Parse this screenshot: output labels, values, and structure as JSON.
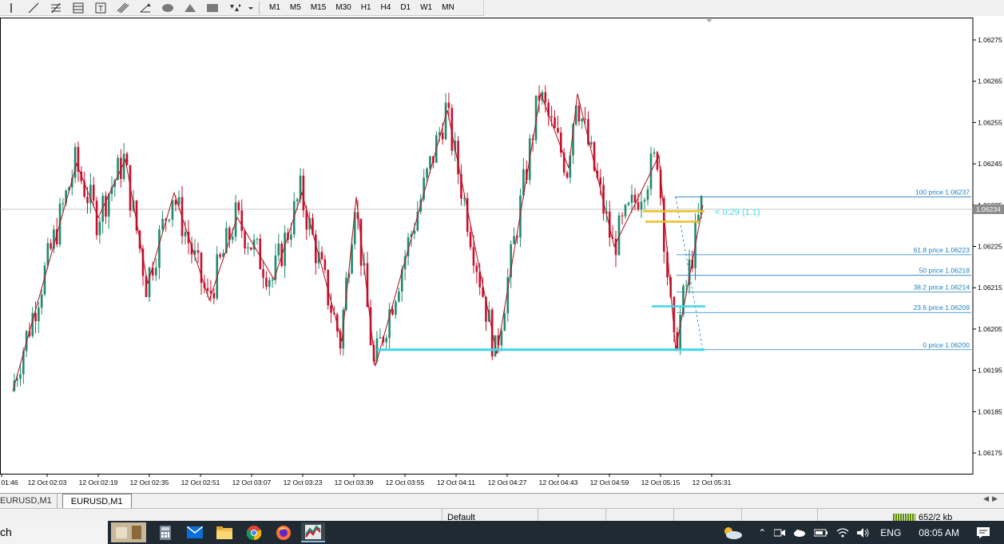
{
  "toolbar": {
    "icons": [
      "vertical-line-icon",
      "trendline-icon",
      "fibonacci-retracement-icon",
      "fibonacci-fan-icon",
      "text-icon",
      "text-label-icon",
      "channel-icon",
      "arrow-label-icon",
      "ellipse-icon",
      "triangle-icon",
      "rectangle-icon",
      "arrows-icon"
    ],
    "timeframes": [
      "M1",
      "M5",
      "M15",
      "M30",
      "H1",
      "H4",
      "D1",
      "W1",
      "MN"
    ]
  },
  "chart_data": {
    "type": "candlestick",
    "symbol": "EURUSD,M1",
    "ylim": [
      1.0617,
      1.0628
    ],
    "y_ticks": [
      "1.06275",
      "1.06265",
      "1.06255",
      "1.06245",
      "1.06235",
      "1.06225",
      "1.06215",
      "1.06205",
      "1.06195",
      "1.06185",
      "1.06175"
    ],
    "current_price": "1.06234",
    "x_ticks": [
      "01:46",
      "12 Oct 02:03",
      "12 Oct 02:19",
      "12 Oct 02:35",
      "12 Oct 02:51",
      "12 Oct 03:07",
      "12 Oct 03:23",
      "12 Oct 03:39",
      "12 Oct 03:55",
      "12 Oct 04:11",
      "12 Oct 04:27",
      "12 Oct 04:43",
      "12 Oct 04:59",
      "12 Oct 05:15",
      "12 Oct 05:31"
    ],
    "zigzag": [
      1.0619,
      1.06245,
      1.06232,
      1.06246,
      1.06216,
      1.06238,
      1.06212,
      1.06232,
      1.06217,
      1.06238,
      1.06202,
      1.06237,
      1.06196,
      1.06258,
      1.06199,
      1.06262,
      1.06244,
      1.06262,
      1.06225,
      1.06247,
      1.062,
      1.06235
    ],
    "fibonacci": [
      {
        "label": "100 price 1.06237",
        "price": 1.06237
      },
      {
        "label": "61.8 price 1.06223",
        "price": 1.06223
      },
      {
        "label": "50 price 1.06218",
        "price": 1.06218
      },
      {
        "label": "38.2 price 1.06214",
        "price": 1.06214
      },
      {
        "label": "23.6 price 1.06209",
        "price": 1.06209
      },
      {
        "label": "0 price 1.06200",
        "price": 1.062
      }
    ],
    "annotation": "< 0:29 (1.1)",
    "colors": {
      "bull": "#1e8a6e",
      "bear": "#c8102e",
      "zigzag": "#b0101e",
      "fib": "#1e7fc0",
      "support": "#3ad8e8",
      "box": "#f0c020"
    }
  },
  "tabs": [
    "EURUSD,M1",
    "EURUSD,M1"
  ],
  "statusbar": {
    "profile": "Default",
    "traffic": "652/2 kb"
  },
  "taskbar": {
    "search": "ch",
    "language": "ENG",
    "time": "08:05 AM"
  }
}
